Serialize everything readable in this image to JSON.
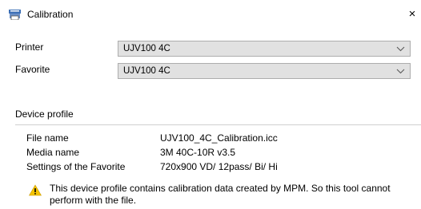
{
  "window": {
    "title": "Calibration",
    "close_glyph": "×",
    "icon": "printer-icon"
  },
  "form": {
    "printer": {
      "label": "Printer",
      "value": "UJV100 4C"
    },
    "favorite": {
      "label": "Favorite",
      "value": "UJV100 4C"
    }
  },
  "device_profile": {
    "heading": "Device profile",
    "rows": [
      {
        "key": "File name",
        "value": "UJV100_4C_Calibration.icc"
      },
      {
        "key": "Media name",
        "value": "3M 40C-10R v3.5"
      },
      {
        "key": "Settings of the Favorite",
        "value": "720x900 VD/ 12pass/ Bi/ Hi"
      }
    ]
  },
  "warning": {
    "icon": "warning-icon",
    "text": "This device profile contains calibration data created by MPM. So this tool cannot perform with the file."
  },
  "colors": {
    "combo_bg": "#e1e1e1",
    "combo_border": "#adadad",
    "warning_yellow": "#f5c400"
  }
}
